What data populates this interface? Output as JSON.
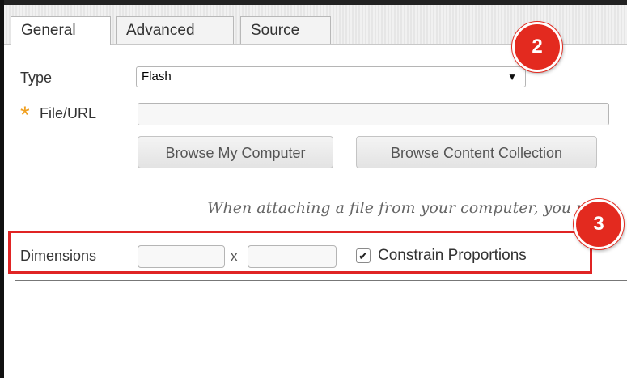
{
  "tabs": [
    {
      "label": "General",
      "active": true
    },
    {
      "label": "Advanced",
      "active": false
    },
    {
      "label": "Source",
      "active": false
    }
  ],
  "type_field": {
    "label": "Type",
    "value": "Flash",
    "options": [
      "Flash"
    ]
  },
  "file_field": {
    "required_marker": "*",
    "label": "File/URL",
    "value": "",
    "required_color": "#f0a020"
  },
  "buttons": {
    "browse_computer": "Browse My Computer",
    "browse_content": "Browse Content Collection"
  },
  "note": "When attaching a file from your computer, you m",
  "dimensions": {
    "label": "Dimensions",
    "width": "",
    "separator": "x",
    "height": "",
    "constrain_label": "Constrain Proportions",
    "constrain_checked": true
  },
  "callouts": {
    "badge_2": "2",
    "badge_3": "3",
    "color": "#e32a1f",
    "highlight_color": "#e02424"
  },
  "icons": {
    "dropdown": "dropdown-arrow-icon",
    "required": "asterisk-icon",
    "checkbox": "check-icon"
  }
}
